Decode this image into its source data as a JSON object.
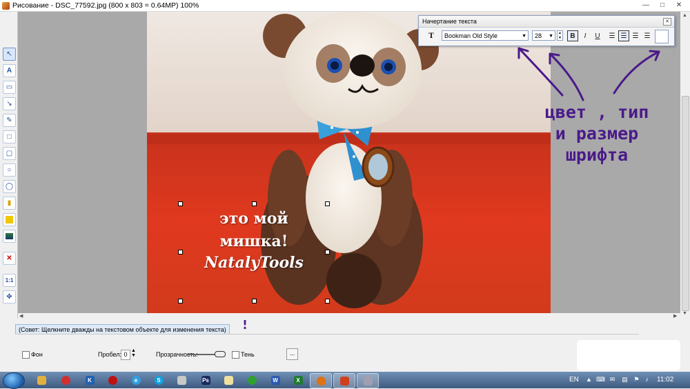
{
  "window": {
    "title": "Рисование  -  DSC_77592.jpg   (800 x 803 = 0.64MP)    100%",
    "minimize": "—",
    "maximize": "□",
    "close": "✕"
  },
  "overlay_text": {
    "line1": "это мой",
    "line2": "мишка!",
    "line3": "NatalyTools"
  },
  "text_panel": {
    "title": "Начертание текста",
    "close": "✕",
    "text_icon": "T",
    "font_family": "Bookman Old Style",
    "font_size": "28",
    "bold": "B",
    "italic": "I",
    "underline": "U",
    "align_active": "center"
  },
  "annotation": {
    "line1": "цвет , тип",
    "line2": "и размер",
    "line3": "шрифта",
    "mark": "!",
    "color": "#4a1a8a"
  },
  "hint": "(Совет: Щелкните дважды на текстовом объекте для изменения текста)",
  "options": {
    "background_label": "Фон",
    "spacing_label": "Пробел:",
    "spacing_value": "0",
    "transparency_label": "Прозрачность:",
    "shadow_label": "Тень",
    "more_button": "..."
  },
  "toolbar": {
    "tools": [
      "select-icon",
      "text-icon",
      "callout-icon",
      "arrow-icon",
      "pencil-icon",
      "rectangle-icon",
      "rounded-rect-icon",
      "ellipse-icon",
      "ellipse-outline-icon",
      "highlighter-icon",
      "fill-icon",
      "image-icon",
      "delete-icon",
      "actual-size-icon",
      "settings-icon"
    ]
  },
  "taskbar": {
    "language": "EN",
    "time": "11:02"
  },
  "colors": {
    "photo_wall": "#eadfd5",
    "photo_floor": "#d9301a",
    "annotation": "#4a1a8a"
  }
}
